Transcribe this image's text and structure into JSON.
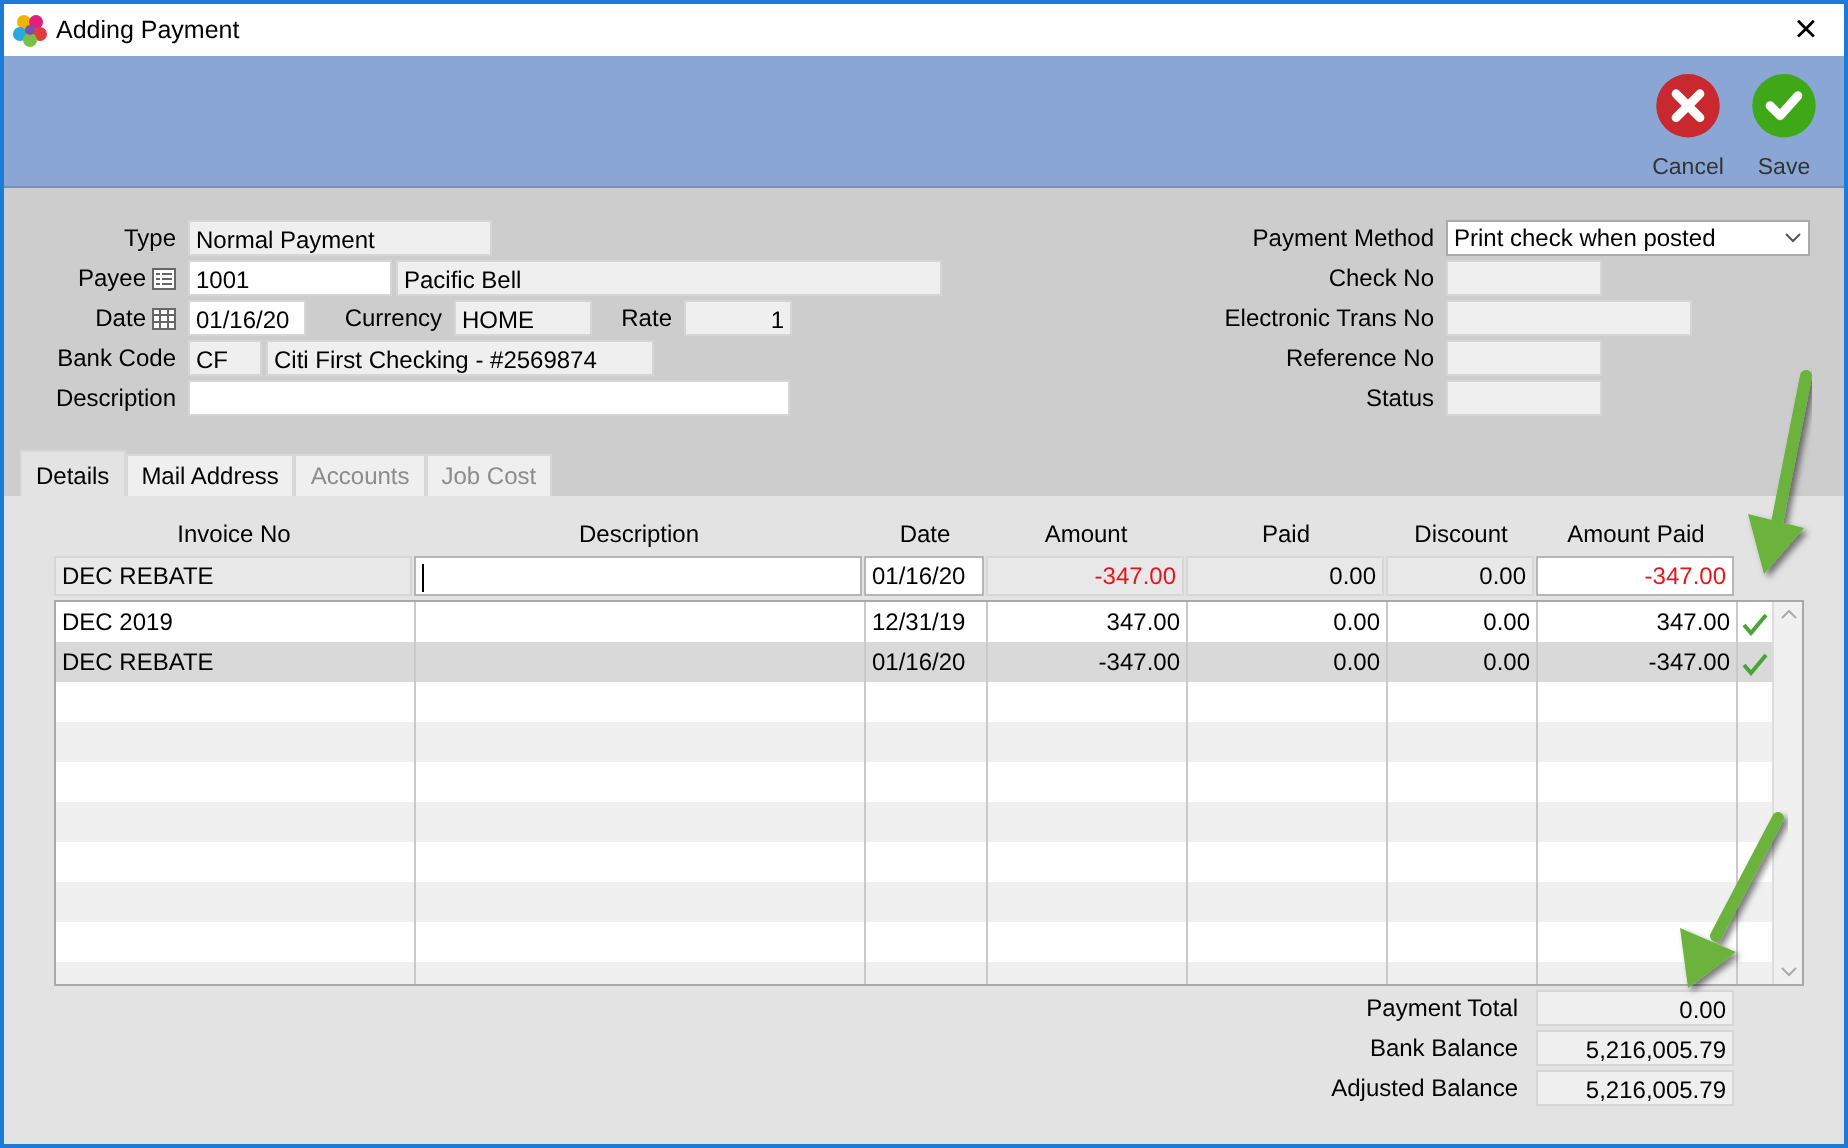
{
  "window": {
    "title": "Adding Payment",
    "close": "×"
  },
  "toolbar": {
    "buttons": [
      {
        "kind": "cancel",
        "label": "Cancel"
      },
      {
        "kind": "save",
        "label": "Save"
      }
    ]
  },
  "form": {
    "type": {
      "label": "Type",
      "value": "Normal Payment"
    },
    "payee": {
      "label": "Payee",
      "code": "1001",
      "name": "Pacific Bell"
    },
    "date": {
      "label": "Date",
      "value": "01/16/20"
    },
    "currency": {
      "label": "Currency",
      "value": "HOME"
    },
    "rate": {
      "label": "Rate",
      "value": "1"
    },
    "bank_code": {
      "label": "Bank Code",
      "code": "CF",
      "name": "Citi First Checking - #2569874"
    },
    "description": {
      "label": "Description"
    },
    "right": [
      {
        "kind": "dropdown",
        "label": "Payment Method",
        "value": "Print check when posted"
      },
      {
        "kind": "short",
        "label": "Check No"
      },
      {
        "kind": "long",
        "label": "Electronic Trans No"
      },
      {
        "kind": "short",
        "label": "Reference No"
      },
      {
        "kind": "short",
        "label": "Status"
      }
    ]
  },
  "tabs": [
    {
      "label": "Details",
      "selected": true,
      "disabled": false
    },
    {
      "label": "Mail Address",
      "selected": false,
      "disabled": false
    },
    {
      "label": "Accounts",
      "selected": false,
      "disabled": true
    },
    {
      "label": "Job Cost",
      "selected": false,
      "disabled": true
    }
  ],
  "table": {
    "columns": [
      "Invoice No",
      "Description",
      "Date",
      "Amount",
      "Paid",
      "Discount",
      "Amount Paid"
    ],
    "edit_row": [
      {
        "text": "DEC REBATE",
        "editable": false,
        "alert": false
      },
      {
        "editable": true,
        "focused": true,
        "alert": false
      },
      {
        "text": "01/16/20",
        "editable": true,
        "alert": false
      },
      {
        "text": "-347.00",
        "editable": false,
        "alert": true
      },
      {
        "text": "0.00",
        "editable": false,
        "alert": false
      },
      {
        "text": "0.00",
        "editable": false,
        "alert": false
      },
      {
        "text": "-347.00",
        "editable": true,
        "alert": true
      }
    ],
    "rows": [
      {
        "cells": [
          "DEC 2019",
          "",
          "12/31/19",
          "347.00",
          "0.00",
          "0.00",
          "347.00"
        ],
        "checked": true,
        "selected": false
      },
      {
        "cells": [
          "DEC REBATE",
          "",
          "01/16/20",
          "-347.00",
          "0.00",
          "0.00",
          "-347.00"
        ],
        "checked": true,
        "selected": true
      }
    ]
  },
  "totals": [
    {
      "label": "Payment Total",
      "value": "0.00"
    },
    {
      "label": "Bank Balance",
      "value": "5,216,005.79"
    },
    {
      "label": "Adjusted Balance",
      "value": "5,216,005.79"
    }
  ]
}
